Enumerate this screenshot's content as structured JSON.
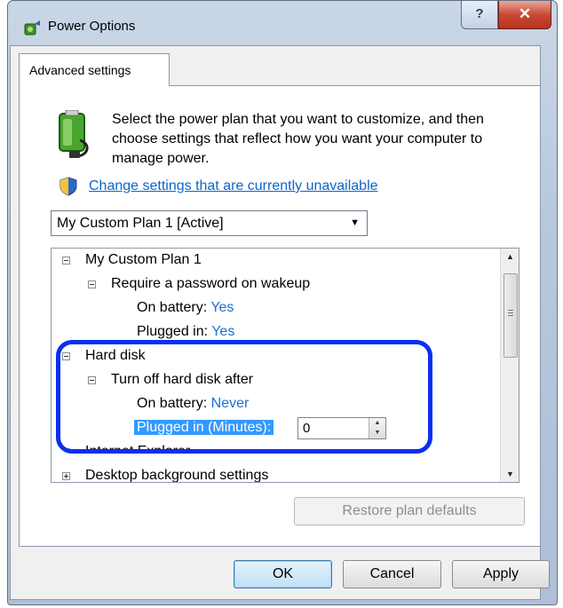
{
  "window": {
    "title": "Power Options",
    "help_label": "?",
    "close_label": "✕"
  },
  "tabs": [
    {
      "label": "Advanced settings"
    }
  ],
  "description": "Select the power plan that you want to customize, and then choose settings that reflect how you want your computer to manage power.",
  "change_settings_link": "Change settings that are currently unavailable",
  "plan_select": {
    "value": "My Custom Plan 1 [Active]"
  },
  "tree": {
    "plan_name": "My Custom Plan 1",
    "password_group": "Require a password on wakeup",
    "password_battery_label": "On battery:",
    "password_battery_value": "Yes",
    "password_plugged_label": "Plugged in:",
    "password_plugged_value": "Yes",
    "hard_disk_group": "Hard disk",
    "turn_off_label": "Turn off hard disk after",
    "disk_battery_label": "On battery:",
    "disk_battery_value": "Never",
    "disk_plugged_label": "Plugged in (Minutes):",
    "disk_plugged_value": "0",
    "internet_explorer": "Internet Explorer",
    "desktop_background": "Desktop background settings"
  },
  "buttons": {
    "restore": "Restore plan defaults",
    "ok": "OK",
    "cancel": "Cancel",
    "apply": "Apply"
  },
  "colors": {
    "link": "#0b66c9",
    "value": "#1c6fd4",
    "selection": "#3399ff",
    "annotation": "#0a2ff0"
  }
}
